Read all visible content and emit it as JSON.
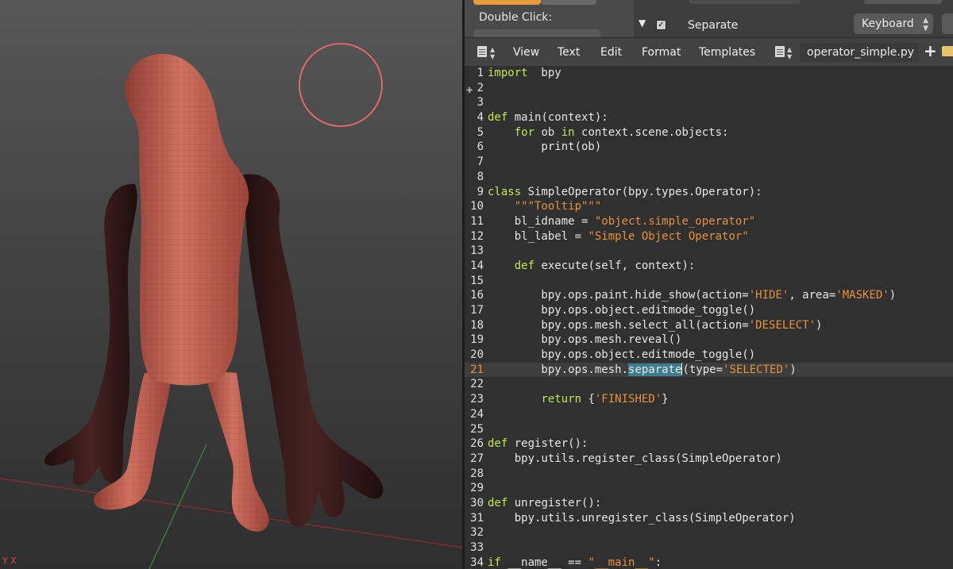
{
  "viewport": {
    "axis_label": "Y X",
    "brush_color": "#f06a6a",
    "mesh_color": "#c86455",
    "masked_color": "#3a1c1a"
  },
  "properties": {
    "double_click_label": "Double Click:",
    "keymap_item_name": "Separate",
    "keymap_input_type": "Keyboard",
    "keymap_enabled": true
  },
  "editor_header": {
    "menus": [
      "View",
      "Text",
      "Edit",
      "Format",
      "Templates"
    ],
    "filename": "operator_simple.py"
  },
  "code": {
    "current_line": 21,
    "lines": [
      {
        "n": "1",
        "t": [
          [
            "kw",
            "import"
          ],
          [
            "",
            "  bpy"
          ]
        ]
      },
      {
        "n": "2",
        "t": []
      },
      {
        "n": "3",
        "t": []
      },
      {
        "n": "4",
        "t": [
          [
            "kw",
            "def"
          ],
          [
            "",
            " main(context):"
          ]
        ]
      },
      {
        "n": "5",
        "t": [
          [
            "",
            "    "
          ],
          [
            "kw",
            "for"
          ],
          [
            "",
            " ob "
          ],
          [
            "kw",
            "in"
          ],
          [
            "",
            " context.scene.objects:"
          ]
        ]
      },
      {
        "n": "6",
        "t": [
          [
            "",
            "        print(ob)"
          ]
        ]
      },
      {
        "n": "7",
        "t": []
      },
      {
        "n": "8",
        "t": []
      },
      {
        "n": "9",
        "t": [
          [
            "kw",
            "class"
          ],
          [
            "",
            " SimpleOperator(bpy.types.Operator):"
          ]
        ]
      },
      {
        "n": "10",
        "t": [
          [
            "",
            "    "
          ],
          [
            "str",
            "\"\"\"Tooltip\"\"\""
          ]
        ]
      },
      {
        "n": "11",
        "t": [
          [
            "",
            "    bl_idname = "
          ],
          [
            "str",
            "\"object.simple_operator\""
          ]
        ]
      },
      {
        "n": "12",
        "t": [
          [
            "",
            "    bl_label = "
          ],
          [
            "str",
            "\"Simple Object Operator\""
          ]
        ]
      },
      {
        "n": "13",
        "t": []
      },
      {
        "n": "14",
        "t": [
          [
            "",
            "    "
          ],
          [
            "kw",
            "def"
          ],
          [
            "",
            " execute(self, context):"
          ]
        ]
      },
      {
        "n": "15",
        "t": []
      },
      {
        "n": "16",
        "t": [
          [
            "",
            "        bpy.ops.paint.hide_show(action="
          ],
          [
            "str",
            "'HIDE'"
          ],
          [
            "",
            ", area="
          ],
          [
            "str",
            "'MASKED'"
          ],
          [
            "",
            ")"
          ]
        ]
      },
      {
        "n": "17",
        "t": [
          [
            "",
            "        bpy.ops.object.editmode_toggle()"
          ]
        ]
      },
      {
        "n": "18",
        "t": [
          [
            "",
            "        bpy.ops.mesh.select_all(action="
          ],
          [
            "str",
            "'DESELECT'"
          ],
          [
            "",
            ")"
          ]
        ]
      },
      {
        "n": "19",
        "t": [
          [
            "",
            "        bpy.ops.mesh.reveal()"
          ]
        ]
      },
      {
        "n": "20",
        "t": [
          [
            "",
            "        bpy.ops.object.editmode_toggle()"
          ]
        ]
      },
      {
        "n": "21",
        "t": [
          [
            "",
            "        bpy.ops.mesh."
          ],
          [
            "sel",
            "separate"
          ],
          [
            "cursor",
            ""
          ],
          [
            "",
            "(type="
          ],
          [
            "str",
            "'SELECTED'"
          ],
          [
            "",
            ")"
          ]
        ]
      },
      {
        "n": "22",
        "t": []
      },
      {
        "n": "23",
        "t": [
          [
            "",
            "        "
          ],
          [
            "kw",
            "return"
          ],
          [
            "",
            " {"
          ],
          [
            "str",
            "'FINISHED'"
          ],
          [
            "",
            "}"
          ]
        ]
      },
      {
        "n": "24",
        "t": []
      },
      {
        "n": "25",
        "t": []
      },
      {
        "n": "26",
        "t": [
          [
            "kw",
            "def"
          ],
          [
            "",
            " register():"
          ]
        ]
      },
      {
        "n": "27",
        "t": [
          [
            "",
            "    bpy.utils.register_class(SimpleOperator)"
          ]
        ]
      },
      {
        "n": "28",
        "t": []
      },
      {
        "n": "29",
        "t": []
      },
      {
        "n": "30",
        "t": [
          [
            "kw",
            "def"
          ],
          [
            "",
            " unregister():"
          ]
        ]
      },
      {
        "n": "31",
        "t": [
          [
            "",
            "    bpy.utils.unregister_class(SimpleOperator)"
          ]
        ]
      },
      {
        "n": "32",
        "t": []
      },
      {
        "n": "33",
        "t": []
      },
      {
        "n": "34",
        "t": [
          [
            "kw",
            "if"
          ],
          [
            "",
            " __name__ == "
          ],
          [
            "str",
            "\"__main__\""
          ],
          [
            "",
            ":"
          ]
        ]
      }
    ]
  }
}
